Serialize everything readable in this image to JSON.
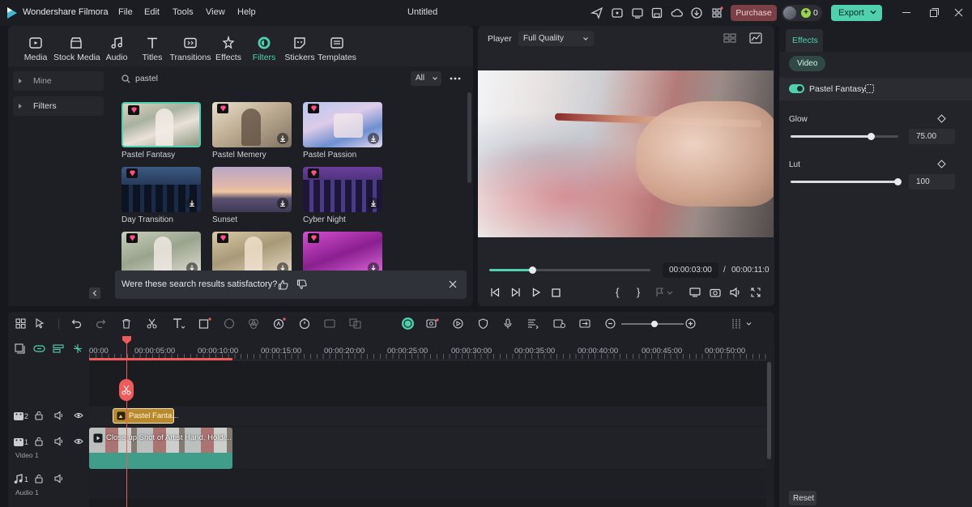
{
  "app": {
    "title": "Wondershare Filmora",
    "doc_title": "Untitled"
  },
  "menu": [
    "File",
    "Edit",
    "Tools",
    "View",
    "Help"
  ],
  "titlebar": {
    "purchase": "Purchase",
    "points": "0",
    "export": "Export"
  },
  "toolbar": [
    {
      "label": "Media",
      "icon": "media-icon"
    },
    {
      "label": "Stock Media",
      "icon": "stock-media-icon"
    },
    {
      "label": "Audio",
      "icon": "audio-icon"
    },
    {
      "label": "Titles",
      "icon": "titles-icon"
    },
    {
      "label": "Transitions",
      "icon": "transitions-icon"
    },
    {
      "label": "Effects",
      "icon": "effects-icon"
    },
    {
      "label": "Filters",
      "icon": "filters-icon",
      "active": true
    },
    {
      "label": "Stickers",
      "icon": "stickers-icon"
    },
    {
      "label": "Templates",
      "icon": "templates-icon"
    }
  ],
  "sidebar": {
    "items": [
      "Mine",
      "Filters"
    ]
  },
  "search": {
    "value": "pastel",
    "filter": "All"
  },
  "filters": [
    {
      "name": "Pastel Fantasy",
      "premium": true,
      "selected": true
    },
    {
      "name": "Pastel Memery",
      "premium": true
    },
    {
      "name": "Pastel Passion",
      "premium": true
    },
    {
      "name": "Day Transition",
      "premium": true
    },
    {
      "name": "Sunset",
      "premium": false
    },
    {
      "name": "Cyber Night",
      "premium": true
    },
    {
      "name": "",
      "premium": true
    },
    {
      "name": "",
      "premium": true
    },
    {
      "name": "",
      "premium": true
    }
  ],
  "feedback": {
    "question": "Were these search results satisfactory?"
  },
  "player": {
    "label": "Player",
    "quality": "Full Quality",
    "current_time": "00:00:03:00",
    "separator": "/",
    "total_time": "00:00:11:0",
    "progress": 0.27
  },
  "inspector": {
    "tab": "Effects",
    "subtab": "Video",
    "effect_name": "Pastel Fantasy",
    "glow": {
      "label": "Glow",
      "value": "75.00",
      "level": 0.75
    },
    "lut": {
      "label": "Lut",
      "value": "100",
      "level": 1.0
    },
    "reset": "Reset"
  },
  "timeline": {
    "ruler": [
      "00:00",
      "00:00:05:00",
      "00:00:10:00",
      "00:00:15:00",
      "00:00:20:00",
      "00:00:25:00",
      "00:00:30:00",
      "00:00:35:00",
      "00:00:40:00",
      "00:00:45:00",
      "00:00:50:00"
    ],
    "filter_clip": "Pastel Fanta...",
    "video_clip": "Close-up Shot of Artist Hand, Holdi...",
    "tracks": [
      {
        "num": "2",
        "name": ""
      },
      {
        "num": "1",
        "name": "Video 1"
      },
      {
        "num": "1",
        "name": "Audio 1"
      }
    ]
  },
  "colors": {
    "accent": "#4fd1b0",
    "purchase": "#7b3f46",
    "clip_filter": "#b88a2e",
    "playhead": "#ef5a5a",
    "video_clip": "#3f9d8a"
  }
}
